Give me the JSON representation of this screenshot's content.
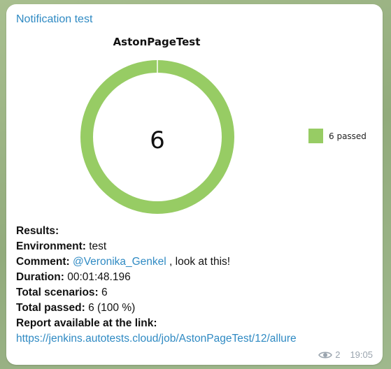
{
  "message": {
    "sender": "Notification test",
    "views": "2",
    "time": "19:05"
  },
  "chart_data": {
    "type": "pie",
    "donut": true,
    "title": "AstonPageTest",
    "center_label": "6",
    "slices": [
      {
        "name": "6 passed",
        "value": 6,
        "color": "#97cc64"
      }
    ],
    "legend_position": "right"
  },
  "report": {
    "results_label": "Results:",
    "environment_label": "Environment:",
    "environment_value": " test",
    "comment_label": "Comment:",
    "comment_mention": "@Veronika_Genkel",
    "comment_rest": " , look at this!",
    "duration_label": "Duration:",
    "duration_value": " 00:01:48.196",
    "total_scenarios_label": "Total scenarios:",
    "total_scenarios_value": " 6",
    "total_passed_label": "Total passed:",
    "total_passed_value": " 6 (100 %)",
    "report_link_label": "Report available at the link:",
    "report_link": "https://jenkins.autotests.cloud/job/AstonPageTest/12/allure"
  }
}
